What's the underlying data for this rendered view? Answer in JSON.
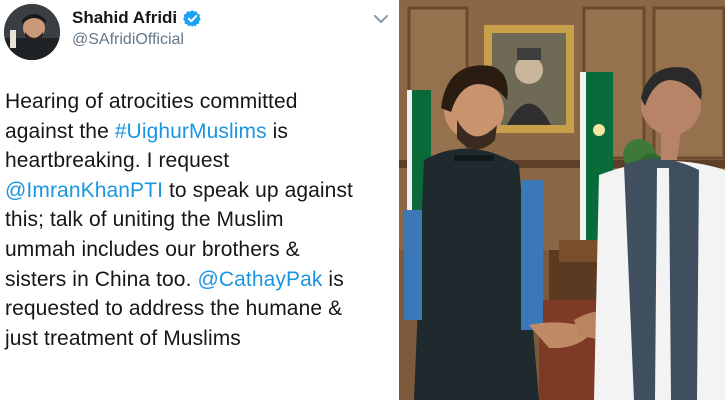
{
  "tweet": {
    "display_name": "Shahid Afridi",
    "handle": "@SAfridiOfficial",
    "verified": true,
    "lines": [
      [
        {
          "t": "Hearing of atrocities committed",
          "link": false
        }
      ],
      [
        {
          "t": "against the ",
          "link": false
        },
        {
          "t": "#UighurMuslims",
          "link": true
        },
        {
          "t": " is",
          "link": false
        }
      ],
      [
        {
          "t": "heartbreaking. I request",
          "link": false
        }
      ],
      [
        {
          "t": "@ImranKhanPTI",
          "link": true
        },
        {
          "t": " to speak up against",
          "link": false
        }
      ],
      [
        {
          "t": "this; talk of uniting the Muslim",
          "link": false
        }
      ],
      [
        {
          "t": "ummah includes our brothers &",
          "link": false
        }
      ],
      [
        {
          "t": "sisters in China too. ",
          "link": false
        },
        {
          "t": "@CathayPak",
          "link": true
        },
        {
          "t": " is",
          "link": false
        }
      ],
      [
        {
          "t": "requested to address the humane &",
          "link": false
        }
      ],
      [
        {
          "t": "just treatment of Muslims",
          "link": false
        }
      ]
    ]
  },
  "colors": {
    "link": "#1b95e0",
    "text": "#14171a",
    "muted": "#657786",
    "verified_badge": "#1da1f2"
  },
  "icons": [
    "verified-badge-icon",
    "chevron-down-icon"
  ],
  "photo": {
    "description_free": true
  }
}
